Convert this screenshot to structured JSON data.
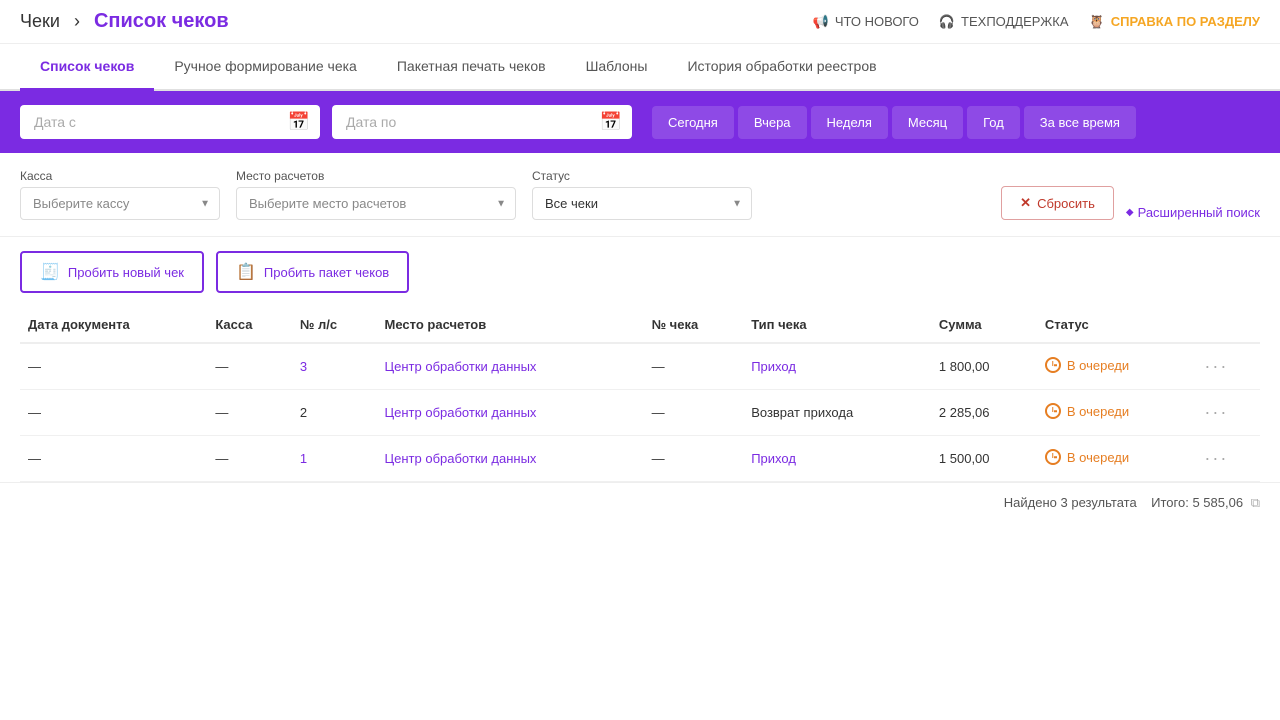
{
  "header": {
    "breadcrumb_base": "Чеки",
    "breadcrumb_sep": "›",
    "breadcrumb_current": "Список чеков",
    "nav": {
      "what_new": "ЧТО НОВОГО",
      "support": "ТЕХПОДДЕРЖКА",
      "help": "СПРАВКА ПО РАЗДЕЛУ"
    }
  },
  "tabs": [
    {
      "id": "list",
      "label": "Список чеков",
      "active": true
    },
    {
      "id": "manual",
      "label": "Ручное формирование чека",
      "active": false
    },
    {
      "id": "batch",
      "label": "Пакетная печать чеков",
      "active": false
    },
    {
      "id": "templates",
      "label": "Шаблоны",
      "active": false
    },
    {
      "id": "history",
      "label": "История обработки реестров",
      "active": false
    }
  ],
  "filter": {
    "date_from_placeholder": "Дата с",
    "date_to_placeholder": "Дата по",
    "period_buttons": [
      {
        "id": "today",
        "label": "Сегодня"
      },
      {
        "id": "yesterday",
        "label": "Вчера"
      },
      {
        "id": "week",
        "label": "Неделя"
      },
      {
        "id": "month",
        "label": "Месяц"
      },
      {
        "id": "year",
        "label": "Год"
      },
      {
        "id": "all",
        "label": "За все время"
      }
    ]
  },
  "secondary_filter": {
    "kassa_label": "Касса",
    "kassa_placeholder": "Выберите кассу",
    "place_label": "Место расчетов",
    "place_placeholder": "Выберите место расчетов",
    "status_label": "Статус",
    "status_value": "Все чеки",
    "reset_btn": "Сбросить",
    "advanced_btn": "Расширенный поиск"
  },
  "actions": {
    "new_check": "Пробить новый чек",
    "batch_check": "Пробить пакет чеков"
  },
  "table": {
    "columns": [
      "Дата документа",
      "Касса",
      "№ л/с",
      "Место расчетов",
      "№ чека",
      "Тип чека",
      "Сумма",
      "Статус"
    ],
    "rows": [
      {
        "date": "—",
        "kassa": "—",
        "account": "3",
        "place": "Центр обработки данных",
        "check_num": "—",
        "type": "Приход",
        "amount": "1 800,00",
        "status": "В очереди",
        "account_link": true
      },
      {
        "date": "—",
        "kassa": "—",
        "account": "2",
        "place": "Центр обработки данных",
        "check_num": "—",
        "type": "Возврат прихода",
        "amount": "2 285,06",
        "status": "В очереди",
        "account_link": false
      },
      {
        "date": "—",
        "kassa": "—",
        "account": "1",
        "place": "Центр обработки данных",
        "check_num": "—",
        "type": "Приход",
        "amount": "1 500,00",
        "status": "В очереди",
        "account_link": true
      }
    ]
  },
  "footer": {
    "found": "Найдено 3 результата",
    "total_label": "Итого:",
    "total_value": "5 585,06"
  },
  "colors": {
    "purple": "#7b2be2",
    "orange": "#e67e22"
  }
}
